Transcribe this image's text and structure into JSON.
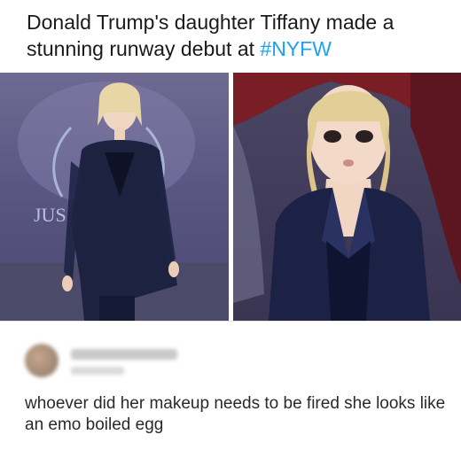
{
  "post": {
    "text": "Donald Trump's daughter Tiffany made a stunning runway debut at ",
    "hashtag": "#NYFW"
  },
  "photos": {
    "left_backdrop_text": "JUS"
  },
  "comment": {
    "text": "whoever did her makeup needs to be fired she looks like an emo boiled egg"
  },
  "colors": {
    "hashtag": "#1da1f2",
    "text": "#1a1a1a"
  }
}
